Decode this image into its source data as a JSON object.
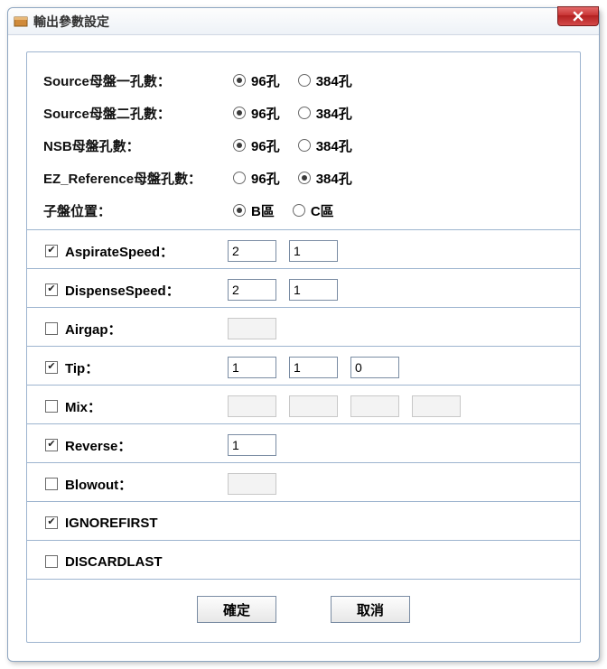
{
  "window": {
    "title": "輸出參數設定"
  },
  "radio_rows": [
    {
      "label": "Source母盤一孔數：",
      "opt1": "96孔",
      "opt2": "384孔",
      "selected": 0
    },
    {
      "label": "Source母盤二孔數：",
      "opt1": "96孔",
      "opt2": "384孔",
      "selected": 0
    },
    {
      "label": "NSB母盤孔數：",
      "opt1": "96孔",
      "opt2": "384孔",
      "selected": 0
    },
    {
      "label": "EZ_Reference母盤孔數：",
      "opt1": "96孔",
      "opt2": "384孔",
      "selected": 1
    },
    {
      "label": "子盤位置：",
      "opt1": "B區",
      "opt2": "C區",
      "selected": 0
    }
  ],
  "params": {
    "aspirate": {
      "label": "AspirateSpeed：",
      "checked": true,
      "v1": "2",
      "v2": "1"
    },
    "dispense": {
      "label": "DispenseSpeed：",
      "checked": true,
      "v1": "2",
      "v2": "1"
    },
    "airgap": {
      "label": "Airgap：",
      "checked": false
    },
    "tip": {
      "label": "Tip：",
      "checked": true,
      "v1": "1",
      "v2": "1",
      "v3": "0"
    },
    "mix": {
      "label": "Mix：",
      "checked": false
    },
    "reverse": {
      "label": "Reverse：",
      "checked": true,
      "v1": "1"
    },
    "blowout": {
      "label": "Blowout：",
      "checked": false
    },
    "ignorefirst": {
      "label": "IGNOREFIRST",
      "checked": true
    },
    "discardlast": {
      "label": "DISCARDLAST",
      "checked": false
    }
  },
  "buttons": {
    "ok": "確定",
    "cancel": "取消"
  }
}
